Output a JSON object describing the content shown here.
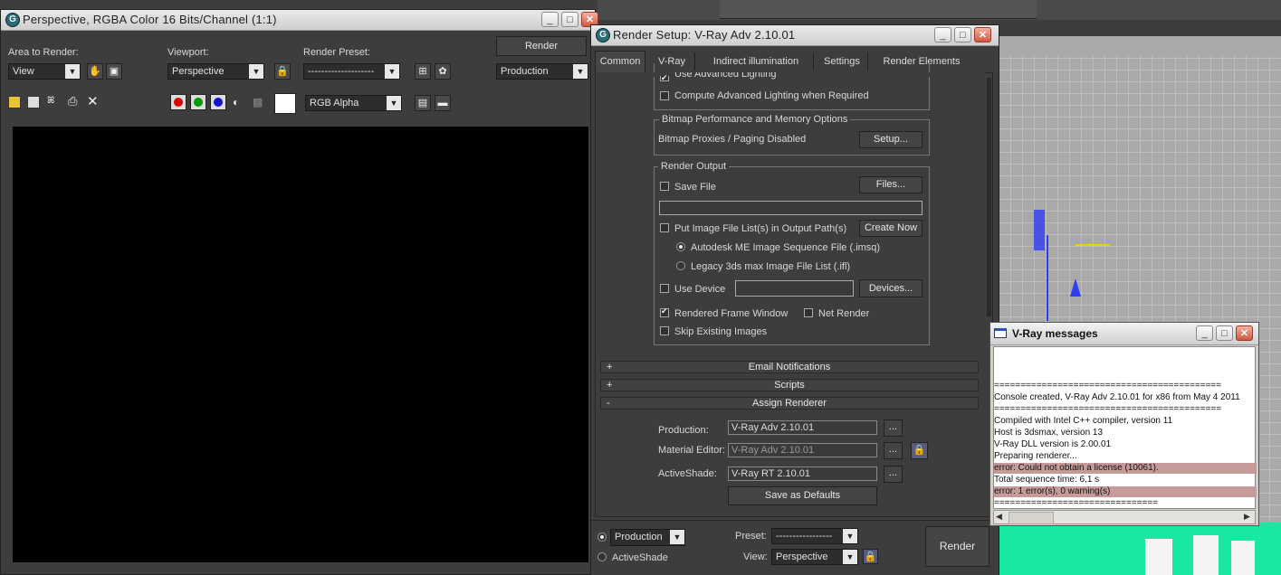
{
  "frame_window": {
    "title": "Perspective, RGBA Color 16 Bits/Channel (1:1)",
    "area_label": "Area to Render:",
    "area_value": "View",
    "viewport_label": "Viewport:",
    "viewport_value": "Perspective",
    "preset_label": "Render Preset:",
    "preset_value": "--------------------",
    "render_button": "Render",
    "mode_value": "Production",
    "channel_value": "RGB Alpha"
  },
  "render_setup": {
    "title": "Render Setup: V-Ray Adv 2.10.01",
    "tabs": [
      "Common",
      "V-Ray",
      "Indirect illumination",
      "Settings",
      "Render Elements"
    ],
    "use_adv_lighting": "Use Advanced Lighting",
    "compute_adv_lighting": "Compute Advanced Lighting when Required",
    "bitmap_group": "Bitmap Performance and Memory Options",
    "bitmap_status": "Bitmap Proxies / Paging Disabled",
    "setup_button": "Setup...",
    "render_output_group": "Render Output",
    "save_file": "Save File",
    "files_button": "Files...",
    "put_image_list": "Put Image File List(s) in Output Path(s)",
    "create_now": "Create Now",
    "autodesk_me": "Autodesk ME Image Sequence File (.imsq)",
    "legacy_list": "Legacy 3ds max Image File List (.ifl)",
    "use_device": "Use Device",
    "devices_button": "Devices...",
    "rendered_frame_window": "Rendered Frame Window",
    "net_render": "Net Render",
    "skip_existing": "Skip Existing Images",
    "rollouts": [
      {
        "sign": "+",
        "label": "Email Notifications"
      },
      {
        "sign": "+",
        "label": "Scripts"
      },
      {
        "sign": "-",
        "label": "Assign Renderer"
      }
    ],
    "production_label": "Production:",
    "production_value": "V-Ray Adv 2.10.01",
    "material_editor_label": "Material Editor:",
    "material_editor_value": "V-Ray Adv 2.10.01",
    "activeshade_label": "ActiveShade:",
    "activeshade_value": "V-Ray RT 2.10.01",
    "browse": "...",
    "save_defaults": "Save as Defaults",
    "bottom_production": "Production",
    "bottom_activeshade": "ActiveShade",
    "bottom_preset_label": "Preset:",
    "bottom_preset_value": "-----------------",
    "bottom_view_label": "View:",
    "bottom_view_value": "Perspective",
    "bottom_render": "Render"
  },
  "vray_messages": {
    "title": "V-Ray messages",
    "lines": [
      {
        "text": "===========================================",
        "error": false
      },
      {
        "text": "Console created, V-Ray Adv 2.10.01 for x86 from May  4 2011",
        "error": false
      },
      {
        "text": "===========================================",
        "error": false
      },
      {
        "text": "Compiled with Intel C++ compiler, version 11",
        "error": false
      },
      {
        "text": "Host is 3dsmax, version 13",
        "error": false
      },
      {
        "text": "V-Ray DLL version is 2.00.01",
        "error": false
      },
      {
        "text": "Preparing renderer...",
        "error": false
      },
      {
        "text": "error: Could not obtain a license (10061).",
        "error": true
      },
      {
        "text": "Total sequence time: 6,1 s",
        "error": false
      },
      {
        "text": "error: 1 error(s), 0 warning(s)",
        "error": true
      },
      {
        "text": "===============================",
        "error": false
      }
    ]
  },
  "colors": {
    "panel_bg": "#3d3d3d",
    "viewport_bg": "#a9a9a9",
    "error_highlight": "#c79a9a"
  }
}
